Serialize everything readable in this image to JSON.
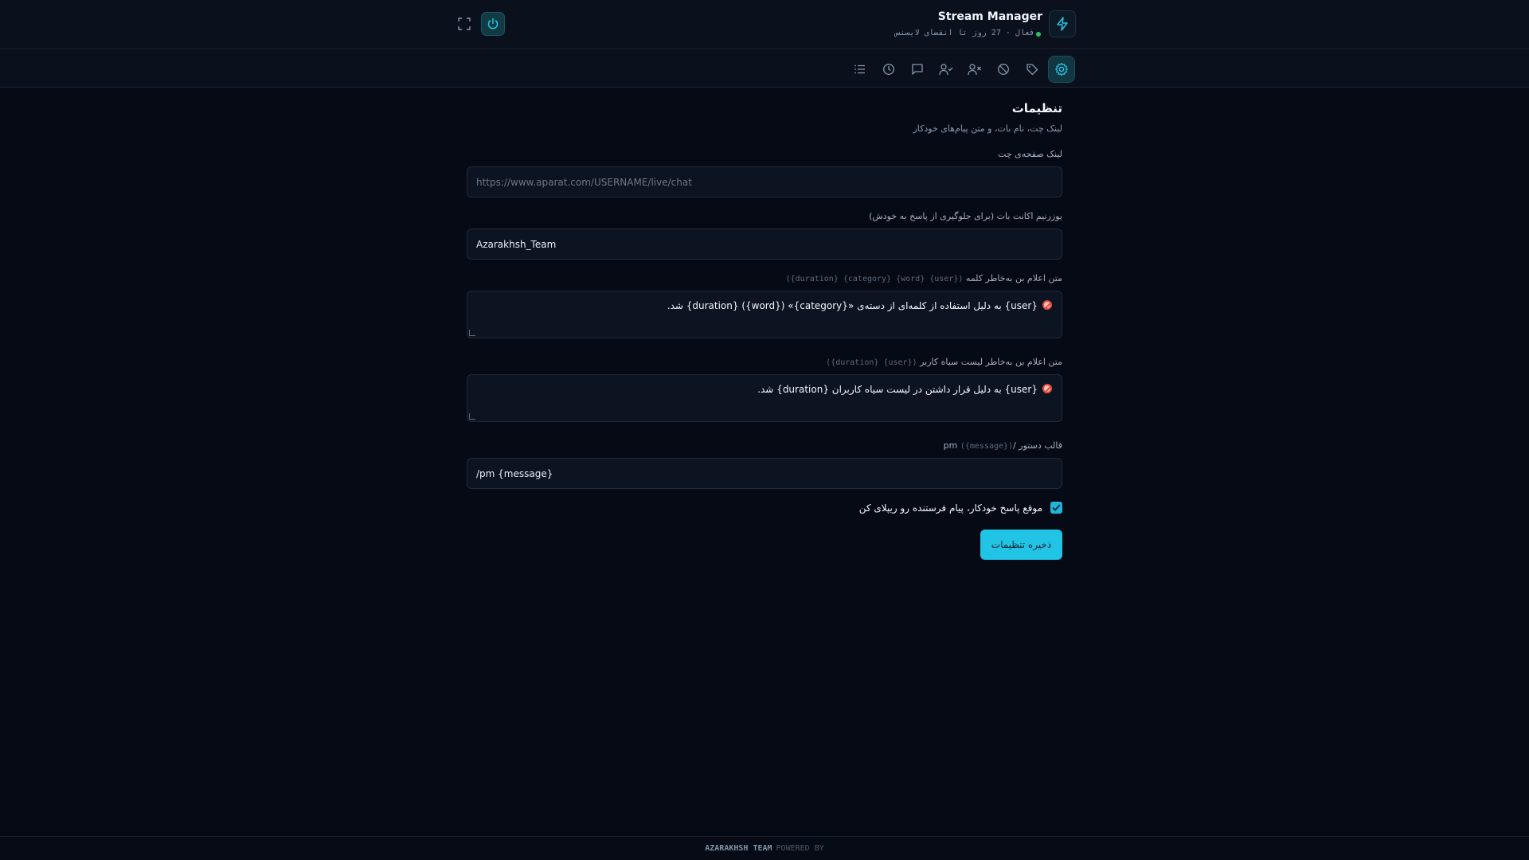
{
  "header": {
    "title": "Stream Manager",
    "status_text": "فعال · 27 روز تا انقضای لایسنس",
    "status_color": "#22c55e",
    "brand_icon": "lightning-icon",
    "power_icon": "power-icon",
    "fullscreen_icon": "fullscreen-icon"
  },
  "toolbar": {
    "items": [
      {
        "icon": "settings-icon",
        "active": true
      },
      {
        "icon": "tag-icon",
        "active": false
      },
      {
        "icon": "ban-icon",
        "active": false
      },
      {
        "icon": "user-x-icon",
        "active": false
      },
      {
        "icon": "user-check-icon",
        "active": false
      },
      {
        "icon": "message-square-icon",
        "active": false
      },
      {
        "icon": "clock-icon",
        "active": false
      },
      {
        "icon": "list-icon",
        "active": false
      }
    ]
  },
  "settings": {
    "title": "تنظیمات",
    "subtitle": "لینک چت، نام بات، و متن پیام‌های خودکار",
    "chat_link": {
      "label": "لینک صفحه‌ی چت",
      "placeholder": "https://www.aparat.com/USERNAME/live/chat",
      "value": ""
    },
    "bot_username": {
      "label": "یوزرنیم اکانت بات (برای جلوگیری از پاسخ به خودش)",
      "value": "Azarakhsh_Team"
    },
    "ban_word_message": {
      "label": "متن اعلام بن به‌خاطر کلمه",
      "hint": "({user} {word} {category} {duration})",
      "value": "{user} به دلیل استفاده از کلمه‌ای از دسته‌ی «{category}» ({word}) {duration} شد."
    },
    "ban_blacklist_message": {
      "label": "متن اعلام بن به‌خاطر لیست سیاه کاربر",
      "hint": "({user} {duration})",
      "value": "{user} به دلیل قرار داشتن در لیست سیاه کاربران {duration} شد."
    },
    "pm_template": {
      "label": "قالب دستور /",
      "label_suffix": "pm",
      "hint": "({message})",
      "value": "/pm {message}"
    },
    "reply_checkbox": {
      "label": "موقع پاسخ خودکار، پیام فرستنده رو ریپلای کن",
      "checked": true
    },
    "save_label": "ذخیره تنظیمات"
  },
  "footer": {
    "powered_by": "POWERED BY",
    "team": "AZARAKHSH TEAM"
  },
  "colors": {
    "accent": "#22c4e6",
    "background": "#050a14"
  }
}
